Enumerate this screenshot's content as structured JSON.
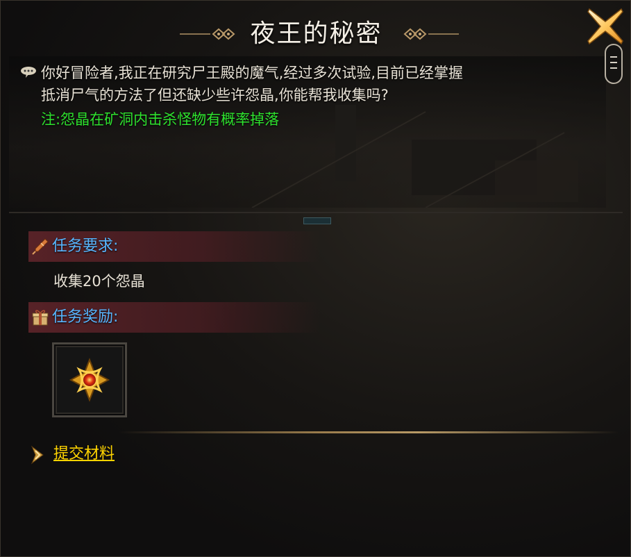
{
  "window": {
    "title": "夜王的秘密",
    "close_icon": "close-x-icon"
  },
  "dialog": {
    "speaker_icon": "speech-bubble-icon",
    "lines": [
      "你好冒险者,我正在研究尸王殿的魔气,经过多次试验,目前已经掌握",
      "抵消尸气的方法了但还缺少些许怨晶,你能帮我收集吗?"
    ],
    "note": "注:怨晶在矿洞内击杀怪物有概率掉落",
    "note_color": "#2ee12e",
    "text_color": "#e8e2d6"
  },
  "requirements": {
    "icon": "quill-icon",
    "label": "任务要求:",
    "text": "收集20个怨晶"
  },
  "rewards": {
    "icon": "gift-box-icon",
    "label": "任务奖励:",
    "items": [
      {
        "icon": "golden-amulet-icon"
      }
    ]
  },
  "submit": {
    "icon": "arrow-right-icon",
    "label": "提交材料",
    "color": "#ffd400"
  },
  "colors": {
    "section_label": "#58b6ff",
    "section_header_bg": "#5f242a",
    "panel_bg": "#0d0c0c"
  }
}
